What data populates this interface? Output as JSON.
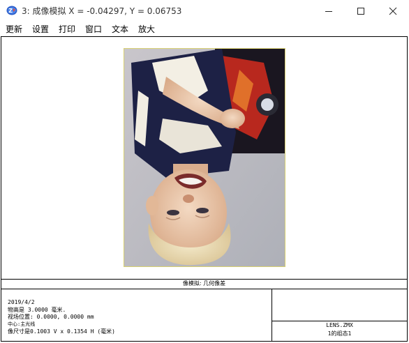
{
  "window": {
    "title": "3: 成像模拟 X = -0.04297, Y = 0.06753",
    "icon": "zemax-app-icon",
    "controls": [
      "minimize-icon",
      "maximize-icon",
      "close-icon"
    ]
  },
  "menu": {
    "items": [
      {
        "label": "更新"
      },
      {
        "label": "设置"
      },
      {
        "label": "打印"
      },
      {
        "label": "窗口"
      },
      {
        "label": "文本"
      },
      {
        "label": "放大"
      }
    ]
  },
  "plot": {
    "image": "upside-down-photo-of-blond-toddler",
    "caption": "像模拟: 几何像差"
  },
  "info": {
    "date": "2019/4/2",
    "object_height": "物高是 3.0000 毫米.",
    "field_position": "视场位置: 0.0000, 0.0000 mm",
    "note": "中心:主光线",
    "image_size": "像尺寸是0.1003 V x 0.1354 H (毫米)"
  },
  "lens": {
    "file": "LENS.ZMX",
    "config": "1的组态1"
  },
  "colors": {
    "frame_border": "#d8d070",
    "background": "#ffffff"
  }
}
